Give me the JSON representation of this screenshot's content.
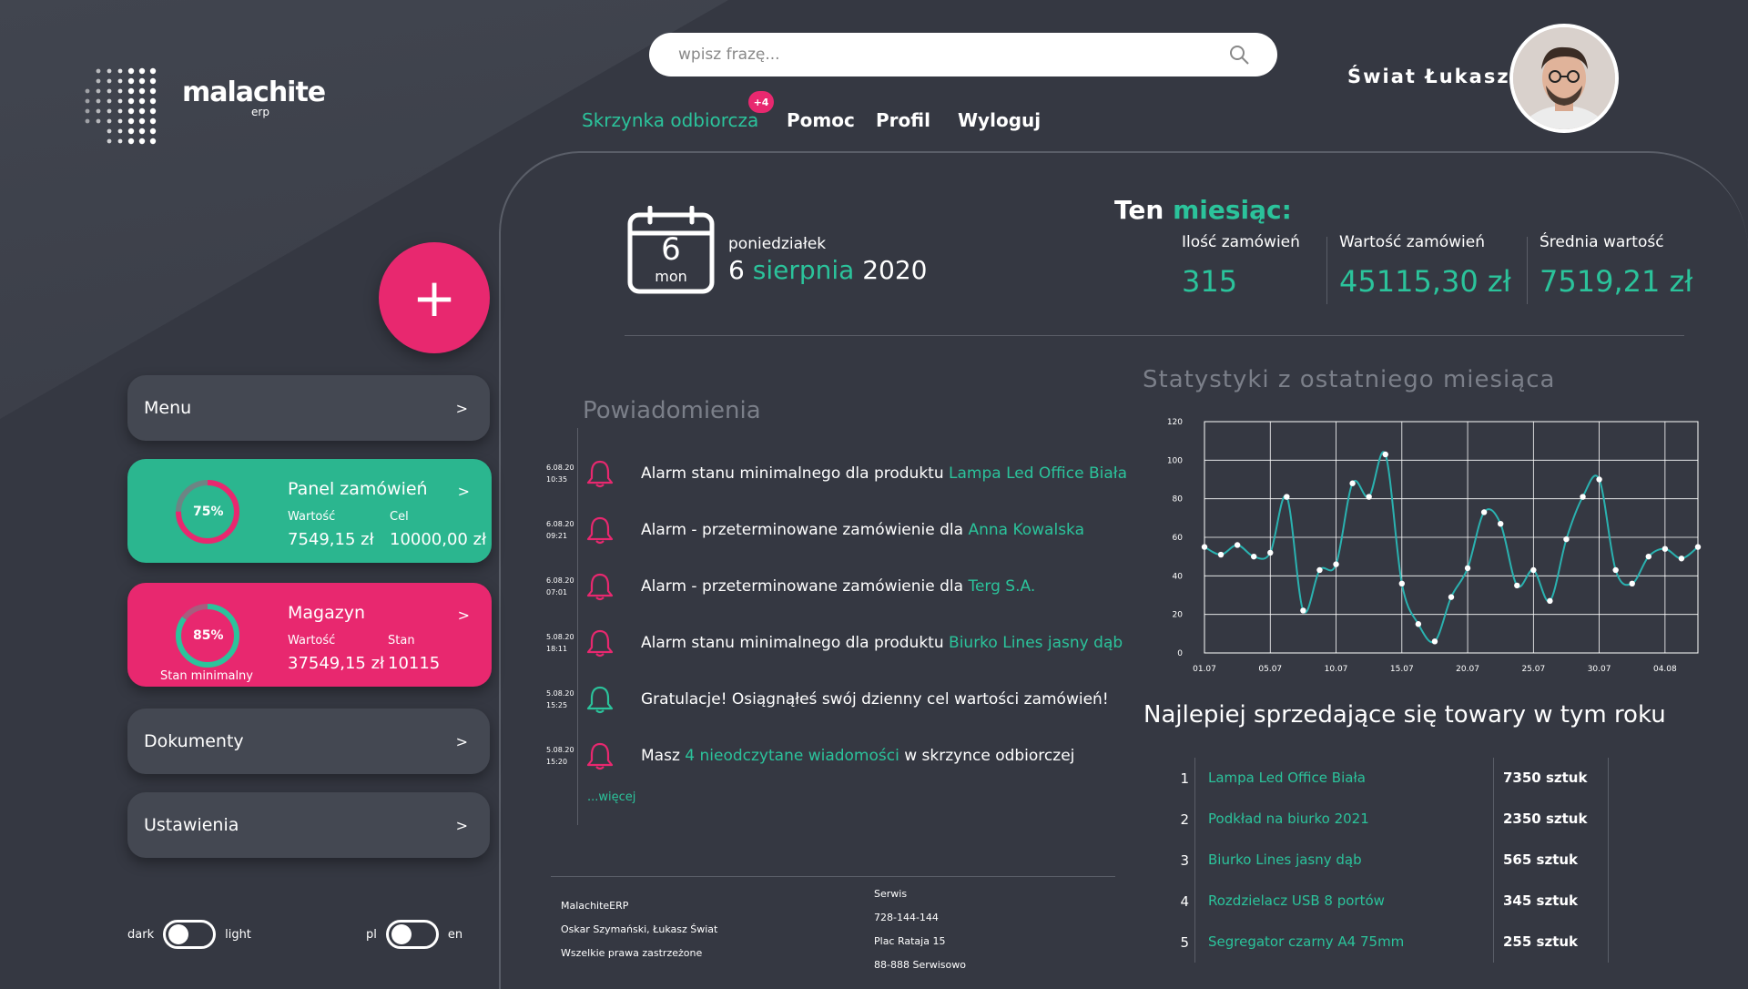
{
  "brand": {
    "name": "malachite",
    "sub": "erp"
  },
  "search": {
    "placeholder": "wpisz frazę..."
  },
  "user": {
    "name": "Świat Łukasz"
  },
  "nav": {
    "inbox": "Skrzynka odbiorcza",
    "inbox_badge": "+4",
    "help": "Pomoc",
    "profile": "Profil",
    "logout": "Wyloguj"
  },
  "sidebar": {
    "add_label": "+",
    "menu": "Menu",
    "documents": "Dokumenty",
    "settings": "Ustawienia",
    "chevron": ">"
  },
  "orders_card": {
    "title": "Panel zamówień",
    "percent_label": "75%",
    "progress": 0.75,
    "value_label": "Wartość",
    "value": "7549,15 zł",
    "goal_label": "Cel",
    "goal": "10000,00 zł"
  },
  "warehouse_card": {
    "title": "Magazyn",
    "percent_label": "85%",
    "progress": 0.85,
    "value_label": "Wartość",
    "value": "37549,15 zł",
    "stock_label": "Stan",
    "stock": "10115",
    "min_label": "Stan minimalny"
  },
  "toggles": {
    "theme_left": "dark",
    "theme_right": "light",
    "lang_left": "pl",
    "lang_right": "en"
  },
  "today": {
    "day_number": "6",
    "day_short": "mon",
    "weekday": "poniedziałek",
    "day": "6",
    "month": "sierpnia",
    "year": "2020"
  },
  "month_stats": {
    "title_a": "Ten",
    "title_b": "miesiąc:",
    "orders_count_label": "Ilość zamówień",
    "orders_count": "315",
    "orders_value_label": "Wartość zamówień",
    "orders_value": "45115,30 zł",
    "avg_value_label": "Średnia wartość",
    "avg_value": "7519,21 zł"
  },
  "notifications": {
    "title": "Powiadomienia",
    "more": "...więcej",
    "items": [
      {
        "date": "6.08.20",
        "time": "10:35",
        "text": "Alarm stanu minimalnego dla produktu ",
        "highlight": "Lampa Led Office Biała",
        "after": "",
        "bell_color": "#e8286f"
      },
      {
        "date": "6.08.20",
        "time": "09:21",
        "text": "Alarm - przeterminowane zamówienie dla ",
        "highlight": "Anna Kowalska",
        "after": "",
        "bell_color": "#e8286f"
      },
      {
        "date": "6.08.20",
        "time": "07:01",
        "text": "Alarm - przeterminowane zamówienie dla ",
        "highlight": "Terg S.A.",
        "after": "",
        "bell_color": "#e8286f"
      },
      {
        "date": "5.08.20",
        "time": "18:11",
        "text": "Alarm stanu minimalnego dla produktu ",
        "highlight": "Biurko Lines jasny dąb",
        "after": "",
        "bell_color": "#e8286f"
      },
      {
        "date": "5.08.20",
        "time": "15:25",
        "text": "Gratulacje! Osiągnąłeś swój dzienny cel wartości zamówień!",
        "highlight": "",
        "after": "",
        "bell_color": "#2bc39b"
      },
      {
        "date": "5.08.20",
        "time": "15:20",
        "text": "Masz ",
        "highlight": "4 nieodczytane wiadomości",
        "after": " w skrzynce odbiorczej",
        "bell_color": "#e8286f"
      }
    ]
  },
  "footer": {
    "company": "MalachiteERP",
    "authors": "Oskar Szymański, Łukasz Świat",
    "rights": "Wszelkie prawa zastrzeżone",
    "service_title": "Serwis",
    "phone": "728-144-144",
    "street": "Plac Rataja 15",
    "city": "88-888 Serwisowo"
  },
  "stats_title": "Statystyki z ostatniego miesiąca",
  "chart_data": {
    "type": "line",
    "title": "Statystyki z ostatniego miesiąca",
    "xlabel": "",
    "ylabel": "",
    "ylim": [
      0,
      120
    ],
    "yticks": [
      0,
      20,
      40,
      60,
      80,
      100,
      120
    ],
    "xticks": [
      "01.07",
      "05.07",
      "10.07",
      "15.07",
      "20.07",
      "25.07",
      "30.07",
      "04.08"
    ],
    "grid": true,
    "color": "#2ab2b0",
    "series": [
      {
        "values": [
          55,
          51,
          56,
          50,
          52,
          81,
          22,
          43,
          46,
          88,
          81,
          103,
          36,
          15,
          6,
          29,
          44,
          73,
          67,
          35,
          43,
          27,
          59,
          81,
          90,
          43,
          36,
          50,
          54,
          49,
          55
        ]
      }
    ]
  },
  "bestsellers": {
    "title": "Najlepiej sprzedające się towary w tym roku",
    "rows": [
      {
        "rank": "1",
        "name": "Lampa Led Office Biała",
        "qty": "7350 sztuk"
      },
      {
        "rank": "2",
        "name": "Podkład na biurko 2021",
        "qty": "2350 sztuk"
      },
      {
        "rank": "3",
        "name": "Biurko Lines jasny dąb",
        "qty": "565 sztuk"
      },
      {
        "rank": "4",
        "name": "Rozdzielacz USB 8 portów",
        "qty": "345 sztuk"
      },
      {
        "rank": "5",
        "name": "Segregator czarny A4 75mm",
        "qty": "255 sztuk"
      }
    ]
  }
}
